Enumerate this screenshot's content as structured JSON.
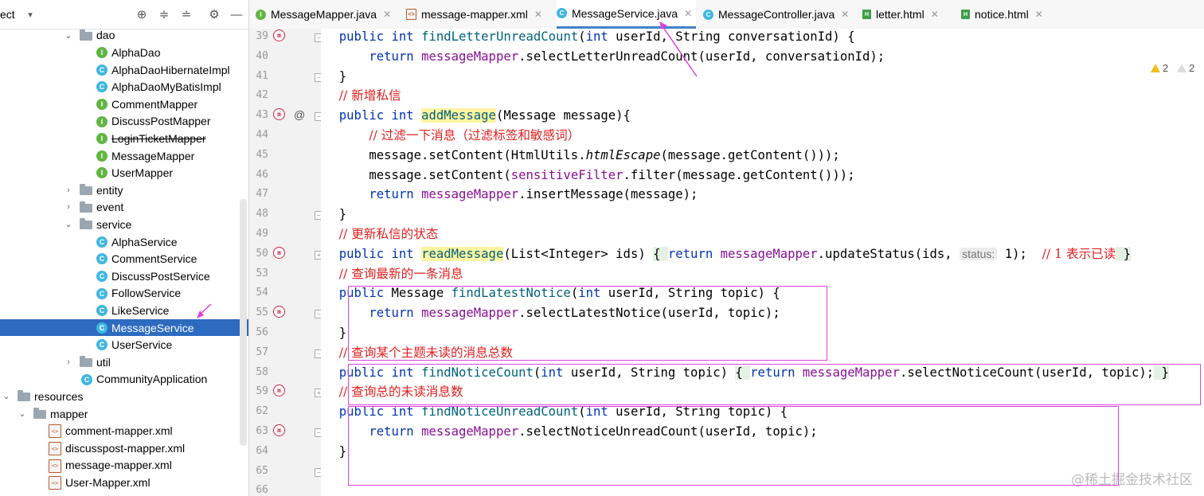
{
  "project_panel": {
    "title": "ect",
    "tree": [
      {
        "label": "dao",
        "type": "folder",
        "indent": 1,
        "arrow": "open"
      },
      {
        "label": "AlphaDao",
        "type": "i",
        "indent": 2
      },
      {
        "label": "AlphaDaoHibernateImpl",
        "type": "c",
        "indent": 2
      },
      {
        "label": "AlphaDaoMyBatisImpl",
        "type": "c",
        "indent": 2
      },
      {
        "label": "CommentMapper",
        "type": "i",
        "indent": 2
      },
      {
        "label": "DiscussPostMapper",
        "type": "i",
        "indent": 2
      },
      {
        "label": "LoginTicketMapper",
        "type": "i",
        "indent": 2,
        "strike": true
      },
      {
        "label": "MessageMapper",
        "type": "i",
        "indent": 2
      },
      {
        "label": "UserMapper",
        "type": "i",
        "indent": 2
      },
      {
        "label": "entity",
        "type": "folder",
        "indent": 1,
        "arrow": "closed"
      },
      {
        "label": "event",
        "type": "folder",
        "indent": 1,
        "arrow": "closed"
      },
      {
        "label": "service",
        "type": "folder",
        "indent": 1,
        "arrow": "open"
      },
      {
        "label": "AlphaService",
        "type": "c",
        "indent": 2
      },
      {
        "label": "CommentService",
        "type": "c",
        "indent": 2
      },
      {
        "label": "DiscussPostService",
        "type": "c",
        "indent": 2
      },
      {
        "label": "FollowService",
        "type": "c",
        "indent": 2
      },
      {
        "label": "LikeService",
        "type": "c",
        "indent": 2
      },
      {
        "label": "MessageService",
        "type": "c",
        "indent": 2,
        "selected": true
      },
      {
        "label": "UserService",
        "type": "c",
        "indent": 2
      },
      {
        "label": "util",
        "type": "folder",
        "indent": 1,
        "arrow": "closed"
      },
      {
        "label": "CommunityApplication",
        "type": "c",
        "indent": 1
      },
      {
        "label": "resources",
        "type": "folder",
        "indent": 0,
        "arrow": "open"
      },
      {
        "label": "mapper",
        "type": "folder",
        "indent": 0.5,
        "arrow": "open"
      },
      {
        "label": "comment-mapper.xml",
        "type": "xml",
        "indent": 1
      },
      {
        "label": "discusspost-mapper.xml",
        "type": "xml",
        "indent": 1
      },
      {
        "label": "message-mapper.xml",
        "type": "xml",
        "indent": 1
      },
      {
        "label": "User-Mapper.xml",
        "type": "xml",
        "indent": 1
      }
    ]
  },
  "tabs": [
    {
      "label": "MessageMapper.java",
      "icon": "i"
    },
    {
      "label": "message-mapper.xml",
      "icon": "x"
    },
    {
      "label": "MessageService.java",
      "icon": "c",
      "active": true
    },
    {
      "label": "MessageController.java",
      "icon": "c"
    },
    {
      "label": "letter.html",
      "icon": "h"
    },
    {
      "label": "notice.html",
      "icon": "h"
    }
  ],
  "inspections": {
    "warnings": "2",
    "weak_warnings": "2"
  },
  "line_numbers": [
    "39",
    "40",
    "41",
    "42",
    "43",
    "44",
    "45",
    "46",
    "47",
    "48",
    "49",
    "50",
    "53",
    "54",
    "55",
    "56",
    "57",
    "58",
    "59",
    "62",
    "63",
    "64",
    "65",
    "66"
  ],
  "code_lines": [
    [
      [
        "  ",
        ""
      ],
      [
        "public int ",
        "kw"
      ],
      [
        "findLetterUnreadCount",
        "fn"
      ],
      [
        "(",
        ""
      ],
      [
        "int ",
        "kw"
      ],
      [
        "userId, String conversationId) {",
        ""
      ]
    ],
    [
      [
        "      ",
        ""
      ],
      [
        "return ",
        "kw"
      ],
      [
        "messageMapper",
        "fld"
      ],
      [
        ".selectLetterUnreadCount(userId, conversationId);",
        ""
      ]
    ],
    [
      [
        "  }",
        ""
      ]
    ],
    [
      [
        "  ",
        ""
      ],
      [
        "// 新增私信",
        "cm"
      ]
    ],
    [
      [
        "  ",
        ""
      ],
      [
        "public int ",
        "kw"
      ],
      [
        "addMessage",
        "fn hl"
      ],
      [
        "(Message message){",
        ""
      ]
    ],
    [
      [
        "      ",
        ""
      ],
      [
        "// 过滤一下消息（过滤标签和敏感词）",
        "cm"
      ]
    ],
    [
      [
        "      message.setContent(HtmlUtils.",
        ""
      ],
      [
        "htmlEscape",
        "it"
      ],
      [
        "(message.getContent()));",
        ""
      ]
    ],
    [
      [
        "      message.setContent(",
        ""
      ],
      [
        "sensitiveFilter",
        "fld"
      ],
      [
        ".filter(message.getContent()));",
        ""
      ]
    ],
    [
      [
        "      ",
        ""
      ],
      [
        "return ",
        "kw"
      ],
      [
        "messageMapper",
        "fld"
      ],
      [
        ".insertMessage(message);",
        ""
      ]
    ],
    [
      [
        "  }",
        ""
      ]
    ],
    [
      [
        "  ",
        ""
      ],
      [
        "// 更新私信的状态",
        "cm"
      ]
    ],
    [
      [
        "  ",
        ""
      ],
      [
        "public int ",
        "kw"
      ],
      [
        "readMessage",
        "fn hl"
      ],
      [
        "(List<Integer> ids) ",
        ""
      ],
      [
        "{ ",
        "foldbox"
      ],
      [
        "return ",
        "kw"
      ],
      [
        "messageMapper",
        "fld"
      ],
      [
        ".updateStatus(ids, ",
        ""
      ],
      [
        "status:",
        "hint"
      ],
      [
        " 1);  ",
        ""
      ],
      [
        "// 1 表示已读",
        "cm"
      ],
      [
        " }",
        "foldbox"
      ]
    ],
    [
      [
        "  ",
        ""
      ],
      [
        "// 查询最新的一条消息",
        "cm"
      ]
    ],
    [
      [
        "  ",
        ""
      ],
      [
        "public ",
        "kw"
      ],
      [
        "Message ",
        ""
      ],
      [
        "findLatestNotice",
        "fn"
      ],
      [
        "(",
        ""
      ],
      [
        "int ",
        "kw"
      ],
      [
        "userId, String topic) {",
        ""
      ]
    ],
    [
      [
        "      ",
        ""
      ],
      [
        "return ",
        "kw"
      ],
      [
        "messageMapper",
        "fld"
      ],
      [
        ".selectLatestNotice(userId, topic);",
        ""
      ]
    ],
    [
      [
        "  }",
        ""
      ]
    ],
    [
      [
        "  ",
        ""
      ],
      [
        "// 查询某个主题未读的消息总数",
        "cm"
      ]
    ],
    [
      [
        "  ",
        ""
      ],
      [
        "public int ",
        "kw"
      ],
      [
        "findNoticeCount",
        "fn"
      ],
      [
        "(",
        ""
      ],
      [
        "int ",
        "kw"
      ],
      [
        "userId, String topic) ",
        ""
      ],
      [
        "{ ",
        "foldbox"
      ],
      [
        "return ",
        "kw"
      ],
      [
        "messageMapper",
        "fld"
      ],
      [
        ".selectNoticeCount(userId, topic);",
        ""
      ],
      [
        " }",
        "foldbox"
      ]
    ],
    [
      [
        "  ",
        ""
      ],
      [
        "// 查询总的未读消息数",
        "cm"
      ]
    ],
    [
      [
        "  ",
        ""
      ],
      [
        "public int ",
        "kw"
      ],
      [
        "findNoticeUnreadCount",
        "fn"
      ],
      [
        "(",
        ""
      ],
      [
        "int ",
        "kw"
      ],
      [
        "userId, String topic) {",
        ""
      ]
    ],
    [
      [
        "      ",
        ""
      ],
      [
        "return ",
        "kw"
      ],
      [
        "messageMapper",
        "fld"
      ],
      [
        ".selectNoticeUnreadCount(userId, topic);",
        ""
      ]
    ],
    [
      [
        "  }",
        ""
      ]
    ],
    [
      [
        "",
        ""
      ]
    ]
  ],
  "watermark": "@稀土掘金技术社区"
}
